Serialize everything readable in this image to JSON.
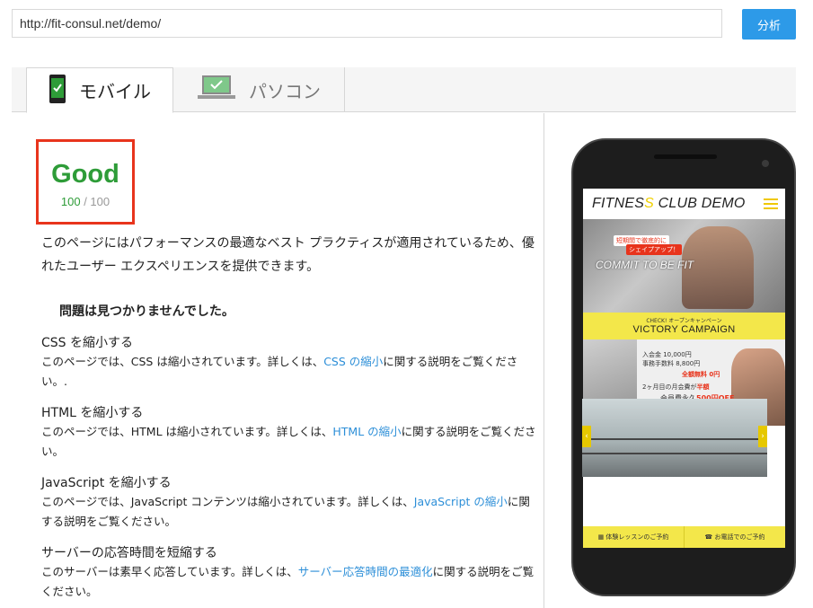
{
  "url_bar": {
    "value": "http://fit-consul.net/demo/",
    "analyze_label": "分析"
  },
  "tabs": [
    {
      "label": "モバイル",
      "icon": "smartphone-check-icon",
      "active": true
    },
    {
      "label": "パソコン",
      "icon": "laptop-check-icon",
      "active": false
    }
  ],
  "score": {
    "rating": "Good",
    "value": "100",
    "max": " / 100",
    "color": "#2e9c38",
    "border_color": "#e8341c"
  },
  "summary": "このページにはパフォーマンスの最適なベスト プラクティスが適用されているため、優れたユーザー エクスペリエンスを提供できます。",
  "no_issues": "問題は見つかりませんでした。",
  "rules": [
    {
      "title": "CSS を縮小する",
      "desc_before": "このページでは、CSS は縮小されています。詳しくは、",
      "link": "CSS の縮小",
      "desc_after": "に関する説明をご覧ください。."
    },
    {
      "title": "HTML を縮小する",
      "desc_before": "このページでは、HTML は縮小されています。詳しくは、",
      "link": "HTML の縮小",
      "desc_after": "に関する説明をご覧ください。"
    },
    {
      "title": "JavaScript を縮小する",
      "desc_before": "このページでは、JavaScript コンテンツは縮小されています。詳しくは、",
      "link": "JavaScript の縮小",
      "desc_after": "に関する説明をご覧ください。"
    },
    {
      "title": "サーバーの応答時間を短縮する",
      "desc_before": "このサーバーは素早く応答しています。詳しくは、",
      "link": "サーバー応答時間の最適化",
      "desc_after": "に関する説明をご覧ください。"
    }
  ],
  "preview": {
    "site_title_pre": "FITNES",
    "site_title_accent": "S",
    "site_title_post": " CLUB DEMO",
    "hero_tag1": "短期間で徹底的に",
    "hero_tag2": "シェイプアップ！",
    "hero_text": "COMMIT TO BE FIT",
    "campaign_sub": "CHECK! オープンキャンペーン",
    "campaign_main": "VICTORY CAMPAIGN",
    "promo_line1": "入会金 10,000円",
    "promo_line2": "事務手数料 8,800円",
    "promo_free": "全額無料 0円",
    "promo_half": "2ヶ月目の月会費が",
    "promo_half_accent": "半額",
    "promo_off": "会員費永久",
    "promo_off_accent": "500円OFF",
    "cta_trial": "体験レッスンのご予約",
    "cta_phone": "お電話でのご予約"
  }
}
